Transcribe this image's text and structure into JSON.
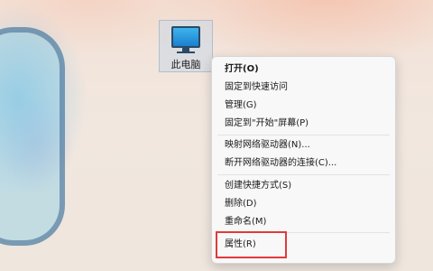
{
  "desktop": {
    "icon": {
      "name": "this-pc-icon",
      "label": "此电脑"
    }
  },
  "context_menu": {
    "items": [
      {
        "label": "打开(O)",
        "bold": true
      },
      {
        "label": "固定到快速访问"
      },
      {
        "label": "管理(G)"
      },
      {
        "label": "固定到\"开始\"屏幕(P)"
      },
      {
        "label": "映射网络驱动器(N)..."
      },
      {
        "label": "断开网络驱动器的连接(C)..."
      },
      {
        "label": "创建快捷方式(S)"
      },
      {
        "label": "删除(D)"
      },
      {
        "label": "重命名(M)"
      },
      {
        "label": "属性(R)",
        "highlighted": true
      }
    ],
    "highlight_color": "#e23a3a"
  }
}
